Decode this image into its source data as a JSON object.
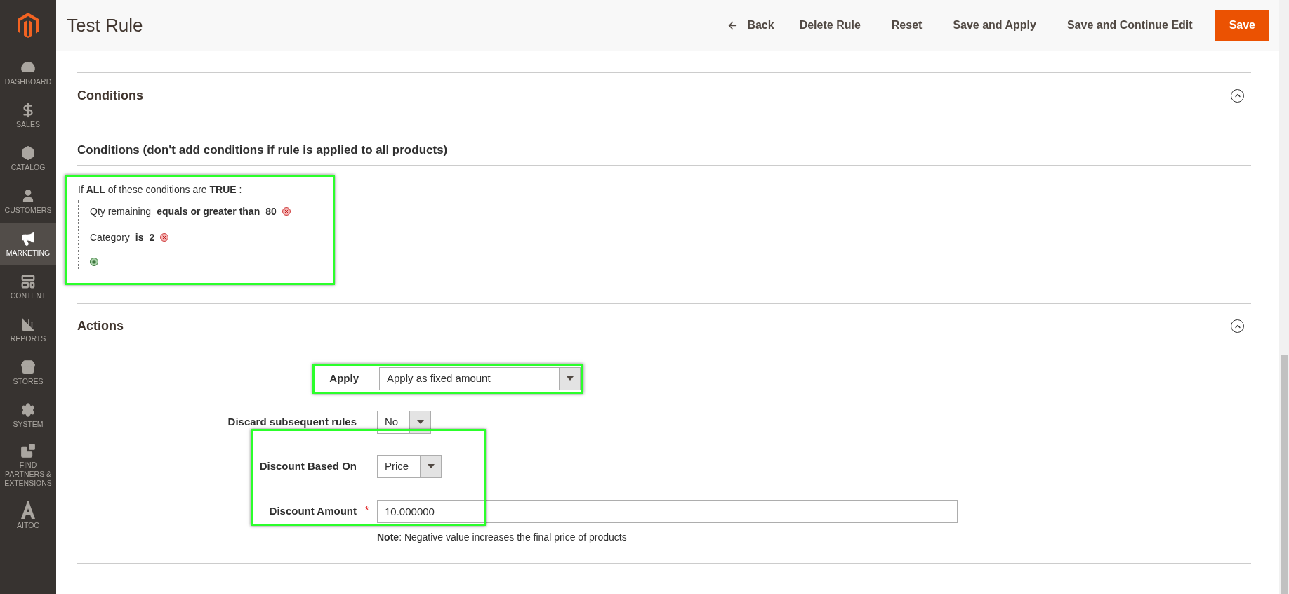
{
  "sidebar": {
    "items": [
      {
        "label": "DASHBOARD",
        "selected": false
      },
      {
        "label": "SALES",
        "selected": false
      },
      {
        "label": "CATALOG",
        "selected": false
      },
      {
        "label": "CUSTOMERS",
        "selected": false
      },
      {
        "label": "MARKETING",
        "selected": true
      },
      {
        "label": "CONTENT",
        "selected": false
      },
      {
        "label": "REPORTS",
        "selected": false
      },
      {
        "label": "STORES",
        "selected": false
      },
      {
        "label": "SYSTEM",
        "selected": false
      },
      {
        "label": "FIND PARTNERS & EXTENSIONS",
        "selected": false
      },
      {
        "label": "AITOC",
        "selected": false
      }
    ]
  },
  "header": {
    "title": "Test Rule",
    "back": "Back",
    "buttons": [
      {
        "label": "Delete Rule",
        "kind": "plain"
      },
      {
        "label": "Reset",
        "kind": "plain"
      },
      {
        "label": "Save and Apply",
        "kind": "plain"
      },
      {
        "label": "Save and Continue Edit",
        "kind": "plain"
      },
      {
        "label": "Save",
        "kind": "primary"
      }
    ]
  },
  "conditions": {
    "title": "Conditions",
    "expanded": true,
    "subtitle": "Conditions (don't add conditions if rule is applied to all products)",
    "intro": "If **ALL**  of these conditions are **TRUE** :",
    "items": [
      {
        "attribute": "Qty remaining",
        "operator": "equals or greater than",
        "value": "80"
      },
      {
        "attribute": "Category",
        "operator": "is",
        "value": "2"
      }
    ]
  },
  "actions": {
    "title": "Actions",
    "expanded": true,
    "fields": [
      {
        "label": "Apply",
        "kind": "select",
        "value": "Apply as fixed amount"
      },
      {
        "label": "Discard subsequent rules",
        "kind": "select",
        "value": "No"
      },
      {
        "label": "Discount Based On",
        "kind": "select",
        "value": "Price"
      },
      {
        "label": "Discount Amount",
        "kind": "input",
        "value": "10.000000",
        "required_mark": "*",
        "note": "**Note**: Negative value increases the final price of products"
      }
    ]
  }
}
